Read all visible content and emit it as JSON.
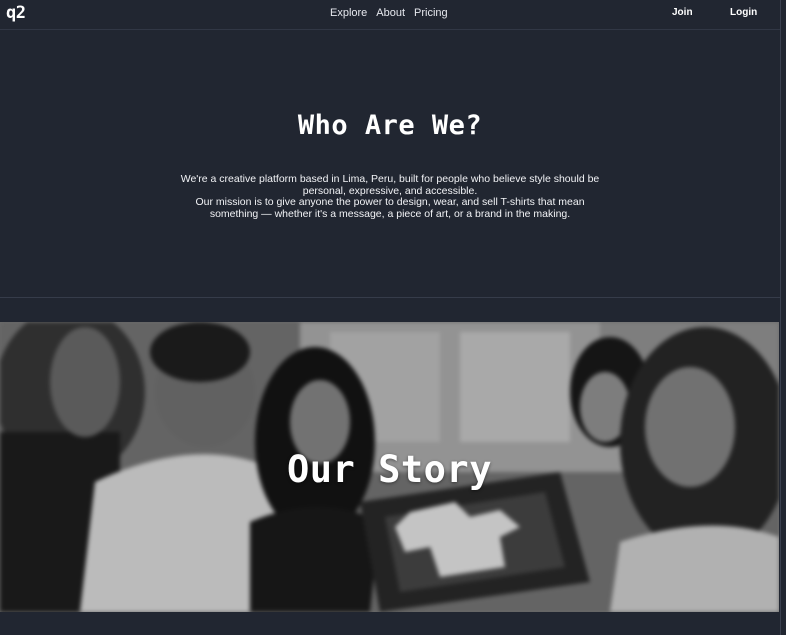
{
  "nav": {
    "logo": "q2",
    "links": [
      "Explore",
      "About",
      "Pricing"
    ],
    "join": "Join",
    "login": "Login"
  },
  "hero": {
    "title": "Who Are We?",
    "paragraph_1": "We're a creative platform based in Lima, Peru, built for people who believe style should be personal, expressive, and accessible.",
    "paragraph_2": "Our mission is to give anyone the power to design, wear, and sell T-shirts that mean something — whether it's a message, a piece of art, or a brand in the making."
  },
  "story": {
    "title": "Our Story",
    "image_icon": "team-photo-icon"
  },
  "colors": {
    "background": "#212631",
    "text": "#ffffff",
    "divider": "#363c4a"
  }
}
